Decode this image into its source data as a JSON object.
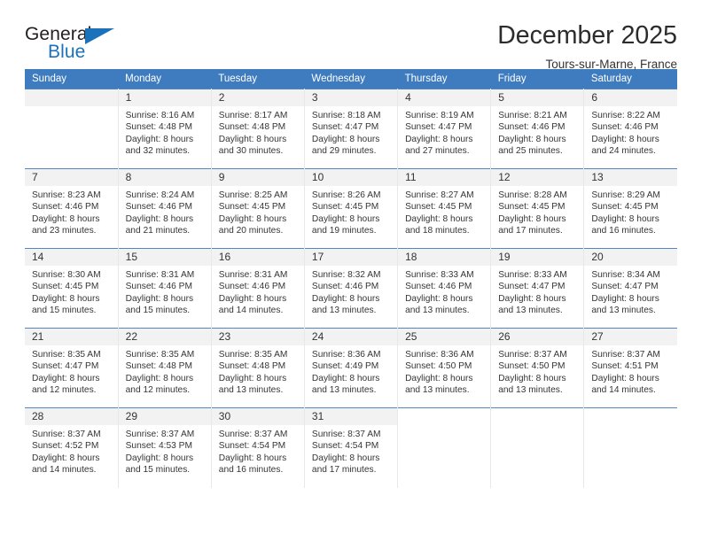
{
  "logo": {
    "word_one": "General",
    "word_two": "Blue",
    "triangle_icon": "triangle-icon",
    "brand_color": "#1b72bb"
  },
  "header": {
    "month_title": "December 2025",
    "location": "Tours-sur-Marne, France"
  },
  "calendar": {
    "header_bg": "#3e7cbf",
    "daynum_bg": "#f2f2f2",
    "weekdays": [
      "Sunday",
      "Monday",
      "Tuesday",
      "Wednesday",
      "Thursday",
      "Friday",
      "Saturday"
    ],
    "weeks": [
      [
        {
          "day": "",
          "sunrise": "",
          "sunset": "",
          "daylight_line1": "",
          "daylight_line2": "",
          "empty": true
        },
        {
          "day": "1",
          "sunrise": "Sunrise: 8:16 AM",
          "sunset": "Sunset: 4:48 PM",
          "daylight_line1": "Daylight: 8 hours",
          "daylight_line2": "and 32 minutes."
        },
        {
          "day": "2",
          "sunrise": "Sunrise: 8:17 AM",
          "sunset": "Sunset: 4:48 PM",
          "daylight_line1": "Daylight: 8 hours",
          "daylight_line2": "and 30 minutes."
        },
        {
          "day": "3",
          "sunrise": "Sunrise: 8:18 AM",
          "sunset": "Sunset: 4:47 PM",
          "daylight_line1": "Daylight: 8 hours",
          "daylight_line2": "and 29 minutes."
        },
        {
          "day": "4",
          "sunrise": "Sunrise: 8:19 AM",
          "sunset": "Sunset: 4:47 PM",
          "daylight_line1": "Daylight: 8 hours",
          "daylight_line2": "and 27 minutes."
        },
        {
          "day": "5",
          "sunrise": "Sunrise: 8:21 AM",
          "sunset": "Sunset: 4:46 PM",
          "daylight_line1": "Daylight: 8 hours",
          "daylight_line2": "and 25 minutes."
        },
        {
          "day": "6",
          "sunrise": "Sunrise: 8:22 AM",
          "sunset": "Sunset: 4:46 PM",
          "daylight_line1": "Daylight: 8 hours",
          "daylight_line2": "and 24 minutes."
        }
      ],
      [
        {
          "day": "7",
          "sunrise": "Sunrise: 8:23 AM",
          "sunset": "Sunset: 4:46 PM",
          "daylight_line1": "Daylight: 8 hours",
          "daylight_line2": "and 23 minutes."
        },
        {
          "day": "8",
          "sunrise": "Sunrise: 8:24 AM",
          "sunset": "Sunset: 4:46 PM",
          "daylight_line1": "Daylight: 8 hours",
          "daylight_line2": "and 21 minutes."
        },
        {
          "day": "9",
          "sunrise": "Sunrise: 8:25 AM",
          "sunset": "Sunset: 4:45 PM",
          "daylight_line1": "Daylight: 8 hours",
          "daylight_line2": "and 20 minutes."
        },
        {
          "day": "10",
          "sunrise": "Sunrise: 8:26 AM",
          "sunset": "Sunset: 4:45 PM",
          "daylight_line1": "Daylight: 8 hours",
          "daylight_line2": "and 19 minutes."
        },
        {
          "day": "11",
          "sunrise": "Sunrise: 8:27 AM",
          "sunset": "Sunset: 4:45 PM",
          "daylight_line1": "Daylight: 8 hours",
          "daylight_line2": "and 18 minutes."
        },
        {
          "day": "12",
          "sunrise": "Sunrise: 8:28 AM",
          "sunset": "Sunset: 4:45 PM",
          "daylight_line1": "Daylight: 8 hours",
          "daylight_line2": "and 17 minutes."
        },
        {
          "day": "13",
          "sunrise": "Sunrise: 8:29 AM",
          "sunset": "Sunset: 4:45 PM",
          "daylight_line1": "Daylight: 8 hours",
          "daylight_line2": "and 16 minutes."
        }
      ],
      [
        {
          "day": "14",
          "sunrise": "Sunrise: 8:30 AM",
          "sunset": "Sunset: 4:45 PM",
          "daylight_line1": "Daylight: 8 hours",
          "daylight_line2": "and 15 minutes."
        },
        {
          "day": "15",
          "sunrise": "Sunrise: 8:31 AM",
          "sunset": "Sunset: 4:46 PM",
          "daylight_line1": "Daylight: 8 hours",
          "daylight_line2": "and 15 minutes."
        },
        {
          "day": "16",
          "sunrise": "Sunrise: 8:31 AM",
          "sunset": "Sunset: 4:46 PM",
          "daylight_line1": "Daylight: 8 hours",
          "daylight_line2": "and 14 minutes."
        },
        {
          "day": "17",
          "sunrise": "Sunrise: 8:32 AM",
          "sunset": "Sunset: 4:46 PM",
          "daylight_line1": "Daylight: 8 hours",
          "daylight_line2": "and 13 minutes."
        },
        {
          "day": "18",
          "sunrise": "Sunrise: 8:33 AM",
          "sunset": "Sunset: 4:46 PM",
          "daylight_line1": "Daylight: 8 hours",
          "daylight_line2": "and 13 minutes."
        },
        {
          "day": "19",
          "sunrise": "Sunrise: 8:33 AM",
          "sunset": "Sunset: 4:47 PM",
          "daylight_line1": "Daylight: 8 hours",
          "daylight_line2": "and 13 minutes."
        },
        {
          "day": "20",
          "sunrise": "Sunrise: 8:34 AM",
          "sunset": "Sunset: 4:47 PM",
          "daylight_line1": "Daylight: 8 hours",
          "daylight_line2": "and 13 minutes."
        }
      ],
      [
        {
          "day": "21",
          "sunrise": "Sunrise: 8:35 AM",
          "sunset": "Sunset: 4:47 PM",
          "daylight_line1": "Daylight: 8 hours",
          "daylight_line2": "and 12 minutes."
        },
        {
          "day": "22",
          "sunrise": "Sunrise: 8:35 AM",
          "sunset": "Sunset: 4:48 PM",
          "daylight_line1": "Daylight: 8 hours",
          "daylight_line2": "and 12 minutes."
        },
        {
          "day": "23",
          "sunrise": "Sunrise: 8:35 AM",
          "sunset": "Sunset: 4:48 PM",
          "daylight_line1": "Daylight: 8 hours",
          "daylight_line2": "and 13 minutes."
        },
        {
          "day": "24",
          "sunrise": "Sunrise: 8:36 AM",
          "sunset": "Sunset: 4:49 PM",
          "daylight_line1": "Daylight: 8 hours",
          "daylight_line2": "and 13 minutes."
        },
        {
          "day": "25",
          "sunrise": "Sunrise: 8:36 AM",
          "sunset": "Sunset: 4:50 PM",
          "daylight_line1": "Daylight: 8 hours",
          "daylight_line2": "and 13 minutes."
        },
        {
          "day": "26",
          "sunrise": "Sunrise: 8:37 AM",
          "sunset": "Sunset: 4:50 PM",
          "daylight_line1": "Daylight: 8 hours",
          "daylight_line2": "and 13 minutes."
        },
        {
          "day": "27",
          "sunrise": "Sunrise: 8:37 AM",
          "sunset": "Sunset: 4:51 PM",
          "daylight_line1": "Daylight: 8 hours",
          "daylight_line2": "and 14 minutes."
        }
      ],
      [
        {
          "day": "28",
          "sunrise": "Sunrise: 8:37 AM",
          "sunset": "Sunset: 4:52 PM",
          "daylight_line1": "Daylight: 8 hours",
          "daylight_line2": "and 14 minutes."
        },
        {
          "day": "29",
          "sunrise": "Sunrise: 8:37 AM",
          "sunset": "Sunset: 4:53 PM",
          "daylight_line1": "Daylight: 8 hours",
          "daylight_line2": "and 15 minutes."
        },
        {
          "day": "30",
          "sunrise": "Sunrise: 8:37 AM",
          "sunset": "Sunset: 4:54 PM",
          "daylight_line1": "Daylight: 8 hours",
          "daylight_line2": "and 16 minutes."
        },
        {
          "day": "31",
          "sunrise": "Sunrise: 8:37 AM",
          "sunset": "Sunset: 4:54 PM",
          "daylight_line1": "Daylight: 8 hours",
          "daylight_line2": "and 17 minutes."
        },
        {
          "day": "",
          "sunrise": "",
          "sunset": "",
          "daylight_line1": "",
          "daylight_line2": "",
          "blank": true
        },
        {
          "day": "",
          "sunrise": "",
          "sunset": "",
          "daylight_line1": "",
          "daylight_line2": "",
          "blank": true
        },
        {
          "day": "",
          "sunrise": "",
          "sunset": "",
          "daylight_line1": "",
          "daylight_line2": "",
          "blank": true
        }
      ]
    ]
  }
}
